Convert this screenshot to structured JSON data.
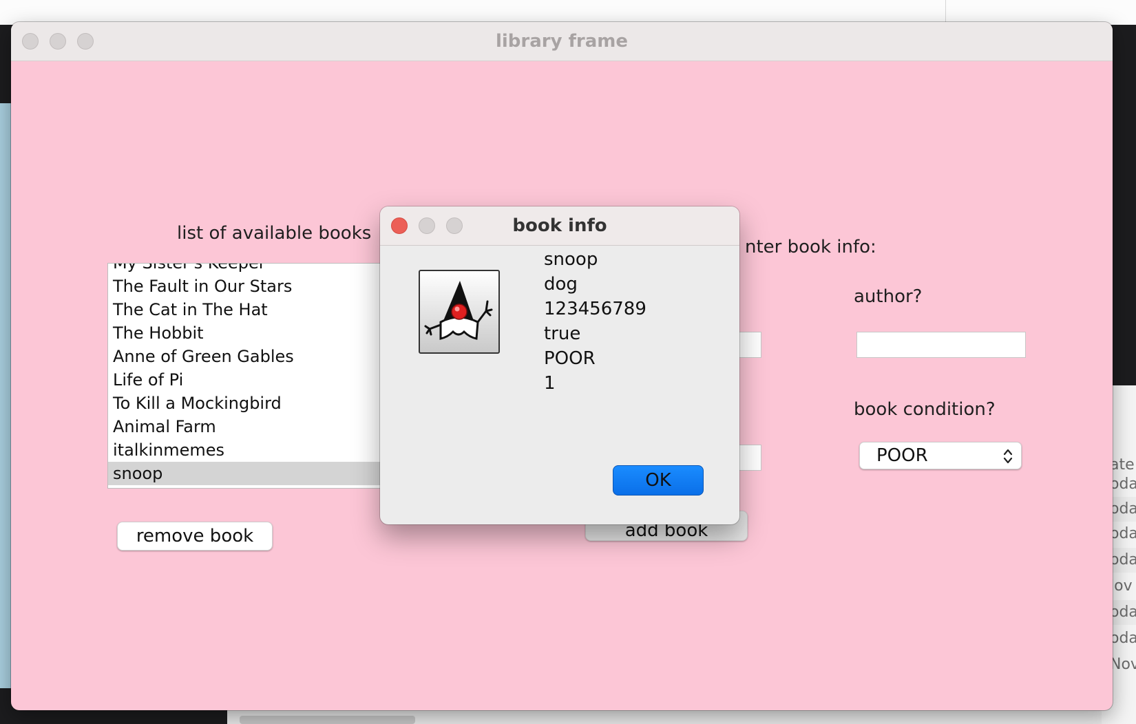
{
  "main_window": {
    "title": "library frame",
    "list_label": "list of available books",
    "books": [
      "My Sister's Keeper",
      "The Fault in Our Stars",
      "The Cat in The Hat",
      "The Hobbit",
      "Anne of Green Gables",
      "Life of Pi",
      "To Kill a Mockingbird",
      "Animal Farm",
      "italkinmemes",
      "snoop"
    ],
    "selected_book": "snoop",
    "remove_button": "remove book",
    "add_button": "add book",
    "enter_info_label": "nter book info:",
    "author_label": "author?",
    "author_value": "",
    "condition_label": "book condition?",
    "condition_value": "POOR"
  },
  "dialog": {
    "title": "book info",
    "icon": "duke-icon",
    "lines": [
      "snoop",
      "dog",
      "123456789",
      "true",
      "POOR",
      "1"
    ],
    "ok_button": "OK"
  },
  "background": {
    "column_header": "ate",
    "cells": [
      "oda",
      "oda",
      "oda",
      "oda",
      "lov",
      "oda",
      "oda",
      "Nov"
    ]
  },
  "colors": {
    "window_background": "#fcc6d6",
    "close_button": "#ec5f57",
    "ok_button": "#0a7aff"
  }
}
